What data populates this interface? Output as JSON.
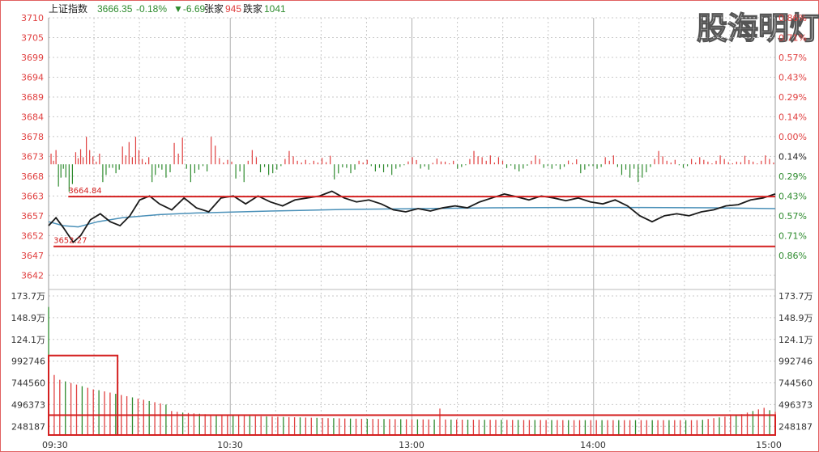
{
  "header": {
    "index_name": "上证指数",
    "price": "3666.35",
    "change_pct": "-0.18%",
    "change_pts": "▼-6.69",
    "up_label": "张家",
    "up_count": "945",
    "down_label": "跌家",
    "down_count": "1041"
  },
  "watermark": "股海明灯",
  "colors": {
    "up": "#e04040",
    "down": "#2e8b2e",
    "price_line": "#1a1a1a",
    "avg_line": "#4a90b8",
    "grid": "#c8c8c8",
    "annotation": "#d42020",
    "frame": "#e06060"
  },
  "chart_data": [
    {
      "type": "line",
      "name": "intraday-price",
      "y_left_ticks": [
        "3710",
        "3705",
        "3699",
        "3694",
        "3689",
        "3684",
        "3678",
        "3673",
        "3668",
        "3663",
        "3657",
        "3652",
        "3647",
        "3642"
      ],
      "y_right_ticks": [
        "0.57%",
        "0.43%",
        "0.29%",
        "0.14%",
        "0.00%",
        "0.14%",
        "0.29%",
        "0.43%",
        "0.57%",
        "0.71%",
        "0.86%"
      ],
      "y_right_ticks_top": [
        "0.86%",
        "0.71%"
      ],
      "ylim": [
        3642,
        3710
      ],
      "prev_close": 3673,
      "x_ticks": [
        "09:30",
        "10:30",
        "13:00",
        "14:00",
        "15:00"
      ],
      "price_series": [
        {
          "t": 0,
          "v": 3657.5
        },
        {
          "t": 3,
          "v": 3659.5
        },
        {
          "t": 6,
          "v": 3657
        },
        {
          "t": 10,
          "v": 3653.3
        },
        {
          "t": 13,
          "v": 3655
        },
        {
          "t": 17,
          "v": 3659
        },
        {
          "t": 21,
          "v": 3660.5
        },
        {
          "t": 25,
          "v": 3658.5
        },
        {
          "t": 29,
          "v": 3657.5
        },
        {
          "t": 33,
          "v": 3660
        },
        {
          "t": 37,
          "v": 3664
        },
        {
          "t": 41,
          "v": 3665
        },
        {
          "t": 45,
          "v": 3663
        },
        {
          "t": 50,
          "v": 3661.5
        },
        {
          "t": 55,
          "v": 3664.5
        },
        {
          "t": 60,
          "v": 3662
        },
        {
          "t": 65,
          "v": 3661
        },
        {
          "t": 70,
          "v": 3664.5
        },
        {
          "t": 75,
          "v": 3665
        },
        {
          "t": 80,
          "v": 3663
        },
        {
          "t": 85,
          "v": 3665
        },
        {
          "t": 90,
          "v": 3663.5
        },
        {
          "t": 95,
          "v": 3662.5
        },
        {
          "t": 100,
          "v": 3664
        },
        {
          "t": 105,
          "v": 3664.5
        },
        {
          "t": 110,
          "v": 3665
        },
        {
          "t": 115,
          "v": 3666.2
        },
        {
          "t": 120,
          "v": 3664.5
        },
        {
          "t": 125,
          "v": 3663.5
        },
        {
          "t": 130,
          "v": 3664
        },
        {
          "t": 135,
          "v": 3663
        },
        {
          "t": 140,
          "v": 3661.5
        },
        {
          "t": 145,
          "v": 3661
        },
        {
          "t": 150,
          "v": 3661.8
        },
        {
          "t": 155,
          "v": 3661.2
        },
        {
          "t": 160,
          "v": 3662
        },
        {
          "t": 165,
          "v": 3662.5
        },
        {
          "t": 170,
          "v": 3662
        },
        {
          "t": 175,
          "v": 3663.5
        },
        {
          "t": 180,
          "v": 3664.5
        },
        {
          "t": 185,
          "v": 3665.5
        },
        {
          "t": 190,
          "v": 3664.8
        },
        {
          "t": 195,
          "v": 3664
        },
        {
          "t": 200,
          "v": 3665
        },
        {
          "t": 205,
          "v": 3664.5
        },
        {
          "t": 210,
          "v": 3663.8
        },
        {
          "t": 215,
          "v": 3664.5
        },
        {
          "t": 220,
          "v": 3663.5
        },
        {
          "t": 225,
          "v": 3663
        },
        {
          "t": 230,
          "v": 3664
        },
        {
          "t": 235,
          "v": 3662.5
        },
        {
          "t": 240,
          "v": 3660
        },
        {
          "t": 245,
          "v": 3658.5
        },
        {
          "t": 250,
          "v": 3660
        },
        {
          "t": 255,
          "v": 3660.5
        },
        {
          "t": 260,
          "v": 3660
        },
        {
          "t": 265,
          "v": 3661
        },
        {
          "t": 270,
          "v": 3661.5
        },
        {
          "t": 275,
          "v": 3662.5
        },
        {
          "t": 280,
          "v": 3662.8
        },
        {
          "t": 285,
          "v": 3664
        },
        {
          "t": 290,
          "v": 3664.5
        },
        {
          "t": 295,
          "v": 3665.5
        }
      ],
      "avg_series": [
        {
          "t": 0,
          "v": 3658.5
        },
        {
          "t": 6,
          "v": 3657.5
        },
        {
          "t": 12,
          "v": 3657.2
        },
        {
          "t": 20,
          "v": 3658.5
        },
        {
          "t": 30,
          "v": 3659.5
        },
        {
          "t": 45,
          "v": 3660.3
        },
        {
          "t": 60,
          "v": 3660.7
        },
        {
          "t": 90,
          "v": 3661.2
        },
        {
          "t": 120,
          "v": 3661.6
        },
        {
          "t": 150,
          "v": 3661.8
        },
        {
          "t": 180,
          "v": 3662
        },
        {
          "t": 210,
          "v": 3662.1
        },
        {
          "t": 240,
          "v": 3662.1
        },
        {
          "t": 270,
          "v": 3662
        },
        {
          "t": 295,
          "v": 3661.8
        }
      ],
      "annotations": [
        {
          "label": "3664.84",
          "value": 3664.84,
          "from_t": 8,
          "to_t": 295
        },
        {
          "label": "3652.27",
          "value": 3652.27,
          "from_t": 2,
          "to_t": 295
        }
      ]
    },
    {
      "type": "bar",
      "name": "volume",
      "y_ticks": [
        "173.7万",
        "148.9万",
        "124.1万",
        "992746",
        "744560",
        "496373",
        "248187"
      ],
      "ylim": [
        0,
        1737000
      ],
      "values": [
        1600000,
        750000,
        690000,
        670000,
        650000,
        630000,
        610000,
        590000,
        570000,
        560000,
        545000,
        530000,
        515000,
        500000,
        485000,
        470000,
        455000,
        440000,
        425000,
        410000,
        395000,
        380000,
        300000,
        290000,
        280000,
        275000,
        270000,
        265000,
        260000,
        255000,
        250000,
        248000,
        246000,
        244000,
        242000,
        240000,
        238000,
        236000,
        234000,
        232000,
        230000,
        228000,
        226000,
        224000,
        222000,
        220000,
        218000,
        216000,
        214000,
        212000,
        210000,
        210000,
        208000,
        206000,
        205000,
        204000,
        203000,
        202000,
        201000,
        200000,
        200000,
        199000,
        198000,
        198000,
        197000,
        196000,
        196000,
        195000,
        195000,
        194000,
        330000,
        194000,
        193000,
        193000,
        192000,
        192000,
        191000,
        191000,
        190000,
        190000,
        190000,
        190000,
        189000,
        189000,
        189000,
        188000,
        188000,
        188000,
        188000,
        187000,
        187000,
        187000,
        187000,
        186000,
        186000,
        186000,
        186000,
        186000,
        186000,
        186000,
        186000,
        186000,
        186000,
        186000,
        186000,
        186000,
        186000,
        186000,
        186000,
        186000,
        186000,
        186000,
        186000,
        186000,
        186000,
        186000,
        186000,
        190000,
        200000,
        210000,
        220000,
        230000,
        240000,
        250000,
        260000,
        280000,
        300000,
        320000,
        340000,
        310000,
        290000
      ],
      "highlight_boxes": [
        {
          "from_t": 0,
          "to_t": 28,
          "y_value": 992746
        },
        {
          "from_t": 0,
          "to_t": 295,
          "y_value": 248187
        }
      ]
    }
  ]
}
